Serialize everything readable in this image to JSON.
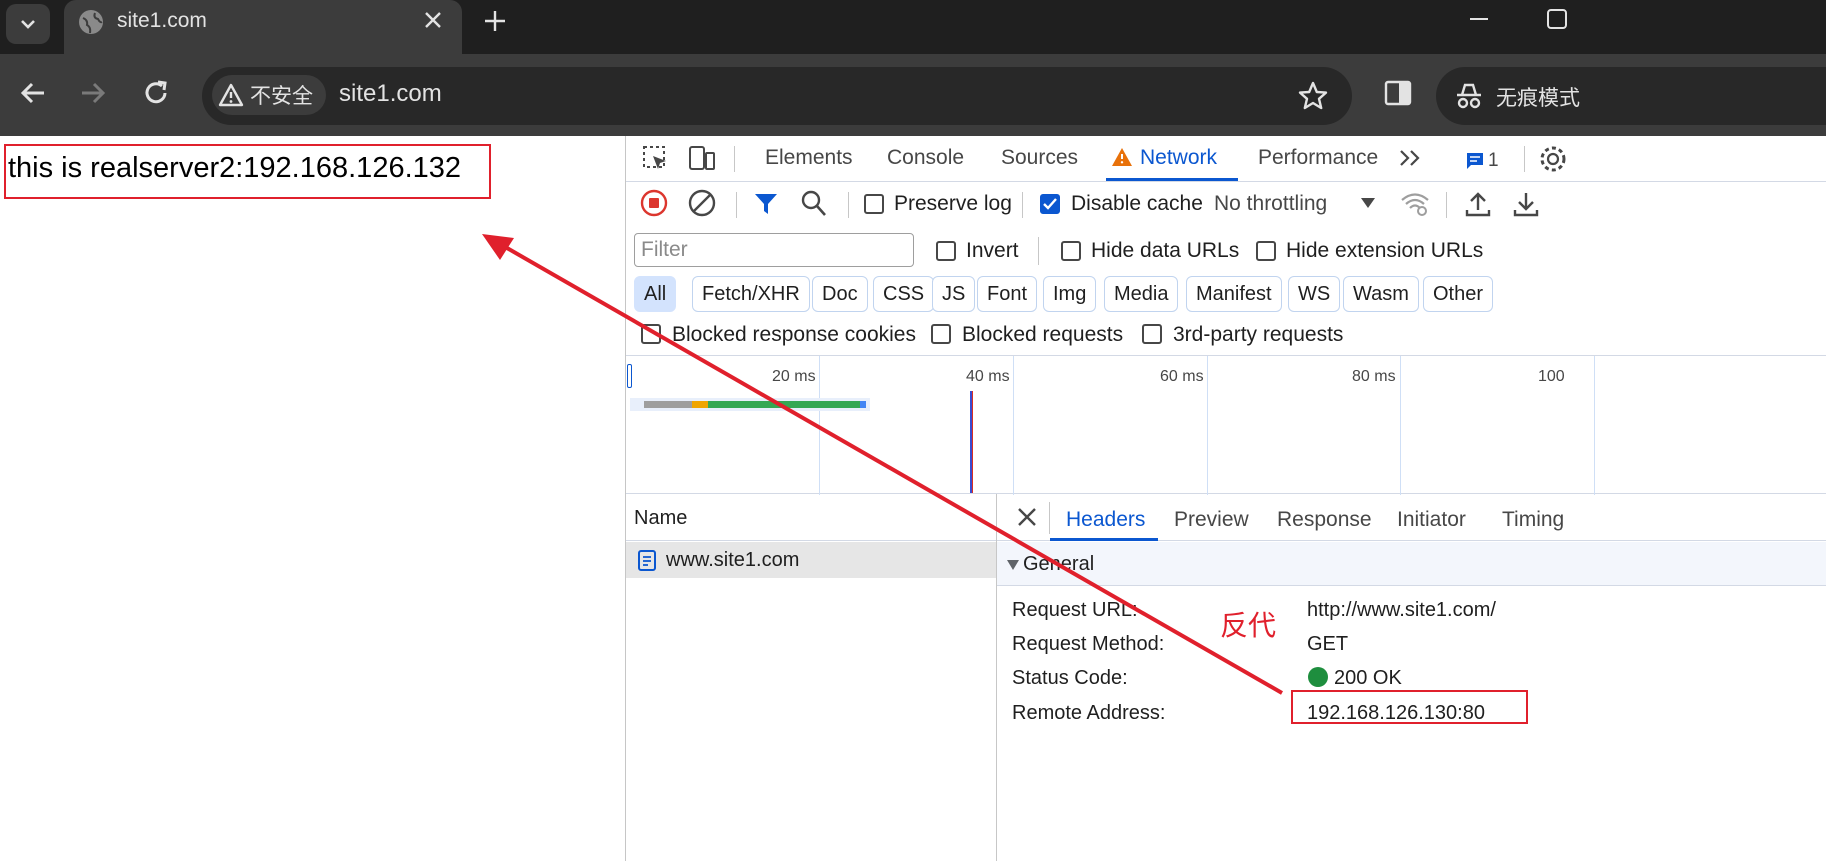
{
  "browser": {
    "tab_title": "site1.com",
    "security_label": "不安全",
    "url": "site1.com",
    "incognito_label": "无痕模式"
  },
  "page": {
    "body_text": "this is realserver2:192.168.126.132"
  },
  "devtools": {
    "tabs": [
      "Elements",
      "Console",
      "Sources",
      "Network",
      "Performance"
    ],
    "active_tab": "Network",
    "issues_count": "1",
    "toolbar": {
      "preserve_log": "Preserve log",
      "disable_cache": "Disable cache",
      "throttling": "No throttling"
    },
    "filter": {
      "placeholder": "Filter",
      "invert": "Invert",
      "hide_data_urls": "Hide data URLs",
      "hide_extension_urls": "Hide extension URLs"
    },
    "type_chips": [
      "All",
      "Fetch/XHR",
      "Doc",
      "CSS",
      "JS",
      "Font",
      "Img",
      "Media",
      "Manifest",
      "WS",
      "Wasm",
      "Other"
    ],
    "more_filters": {
      "blocked_cookies": "Blocked response cookies",
      "blocked_requests": "Blocked requests",
      "third_party": "3rd-party requests"
    },
    "timeline_ticks": [
      "20 ms",
      "40 ms",
      "60 ms",
      "80 ms",
      "100"
    ],
    "request_list": {
      "header": "Name",
      "rows": [
        "www.site1.com"
      ]
    },
    "detail_tabs": [
      "Headers",
      "Preview",
      "Response",
      "Initiator",
      "Timing"
    ],
    "general": {
      "title": "General",
      "request_url_label": "Request URL:",
      "request_url": "http://www.site1.com/",
      "method_label": "Request Method:",
      "method": "GET",
      "status_label": "Status Code:",
      "status": "200 OK",
      "remote_label": "Remote Address:",
      "remote": "192.168.126.130:80"
    }
  },
  "annotation": {
    "text": "反代",
    "color": "#e0202c"
  },
  "colors": {
    "accent": "#0b57d0",
    "status_ok": "#1e8e3e",
    "chrome_dark": "#1f1f1f"
  }
}
